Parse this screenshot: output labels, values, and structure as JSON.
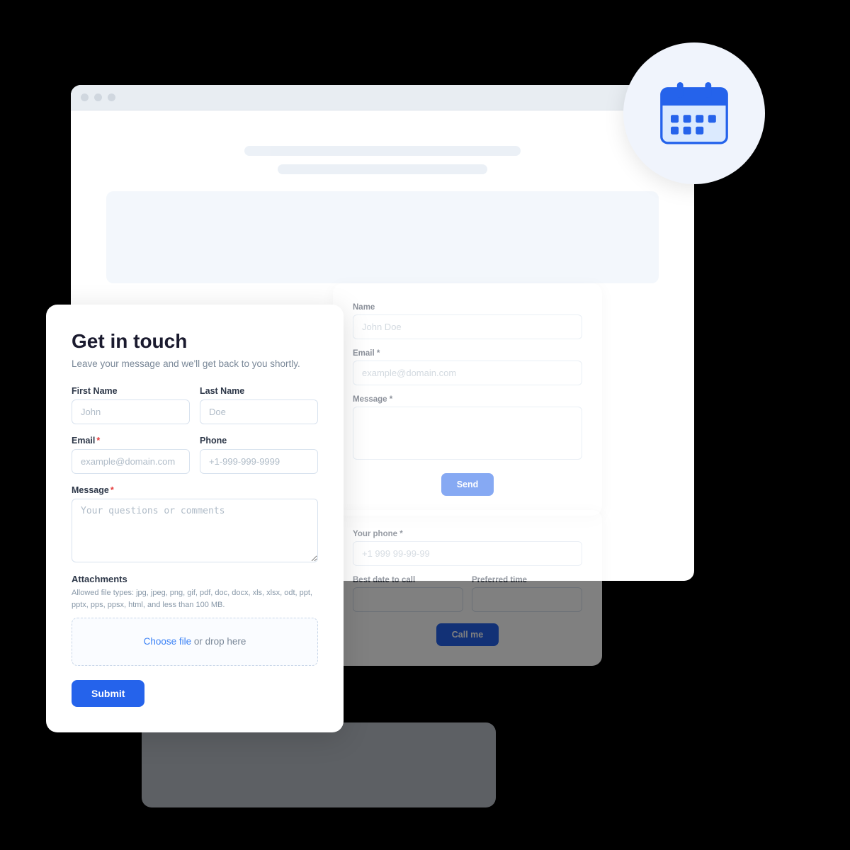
{
  "scene": {
    "bg_browser": {
      "dots": [
        "dot1",
        "dot2",
        "dot3"
      ]
    },
    "calendar_icon": {
      "label": "calendar-icon"
    },
    "main_form": {
      "title": "Get in touch",
      "subtitle": "Leave your message and we'll get back to you shortly.",
      "first_name_label": "First Name",
      "first_name_placeholder": "John",
      "last_name_label": "Last Name",
      "last_name_placeholder": "Doe",
      "email_label": "Email",
      "email_required": "*",
      "email_placeholder": "example@domain.com",
      "phone_label": "Phone",
      "phone_placeholder": "+1-999-999-9999",
      "message_label": "Message",
      "message_required": "*",
      "message_placeholder": "Your questions or comments",
      "attachments_label": "Attachments",
      "attachments_hint": "Allowed file types: jpg, jpeg, png, gif, pdf, doc, docx, xls, xlsx, odt, ppt, pptx, pps, ppsx, html, and less than 100 MB.",
      "file_drop_choose": "Choose file",
      "file_drop_or": " or drop here",
      "submit_label": "Submit"
    },
    "right_form": {
      "name_label": "Name",
      "name_placeholder": "John Doe",
      "email_label": "Email *",
      "email_placeholder": "example@domain.com",
      "message_label": "Message *",
      "send_label": "Send"
    },
    "callback_form": {
      "phone_label": "Your phone *",
      "phone_placeholder": "+1 999 99-99-99",
      "date_label": "Best date to call",
      "time_label": "Preferred time",
      "call_label": "Call me"
    }
  }
}
